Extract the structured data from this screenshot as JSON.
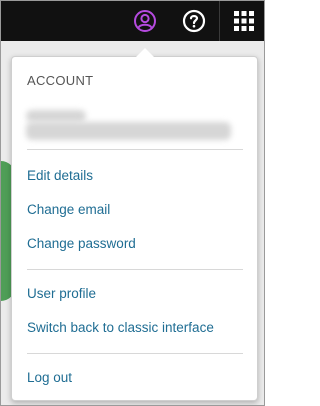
{
  "topbar": {
    "icons": [
      "account-icon",
      "help-icon",
      "apps-grid-icon"
    ],
    "account_color": "#b54adf",
    "background": "#111111"
  },
  "menu": {
    "section_title": "ACCOUNT",
    "items_group1": [
      "Edit details",
      "Change email",
      "Change password"
    ],
    "items_group2": [
      "User profile",
      "Switch back to classic interface"
    ],
    "items_group3": [
      "Log out"
    ],
    "link_color": "#1f6d93"
  }
}
